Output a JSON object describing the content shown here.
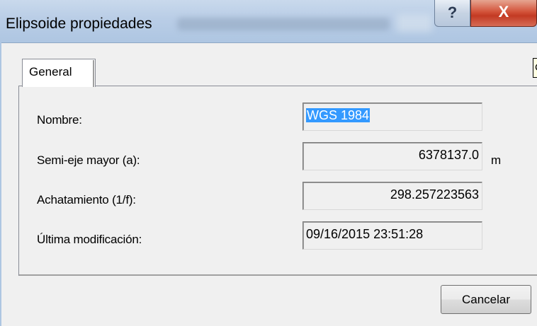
{
  "window": {
    "title": "Elipsoide propiedades",
    "help_glyph": "?",
    "close_glyph": "X"
  },
  "tooltip_fragment": "C",
  "tabs": [
    {
      "label": "General"
    }
  ],
  "fields": {
    "nombre": {
      "label": "Nombre:",
      "value": "WGS 1984"
    },
    "semi_eje": {
      "label": "Semi-eje mayor (a):",
      "value": "6378137.0",
      "unit": "m"
    },
    "achatamiento": {
      "label": "Achatamiento (1/f):",
      "value": "298.257223563"
    },
    "ultima_mod": {
      "label": "Última modificación:",
      "value": "09/16/2015 23:51:28"
    }
  },
  "buttons": {
    "cancel_label": "Cancelar"
  },
  "colors": {
    "selection": "#3399ff",
    "close_button": "#c33a23",
    "titlebar": "#b9cde6"
  }
}
